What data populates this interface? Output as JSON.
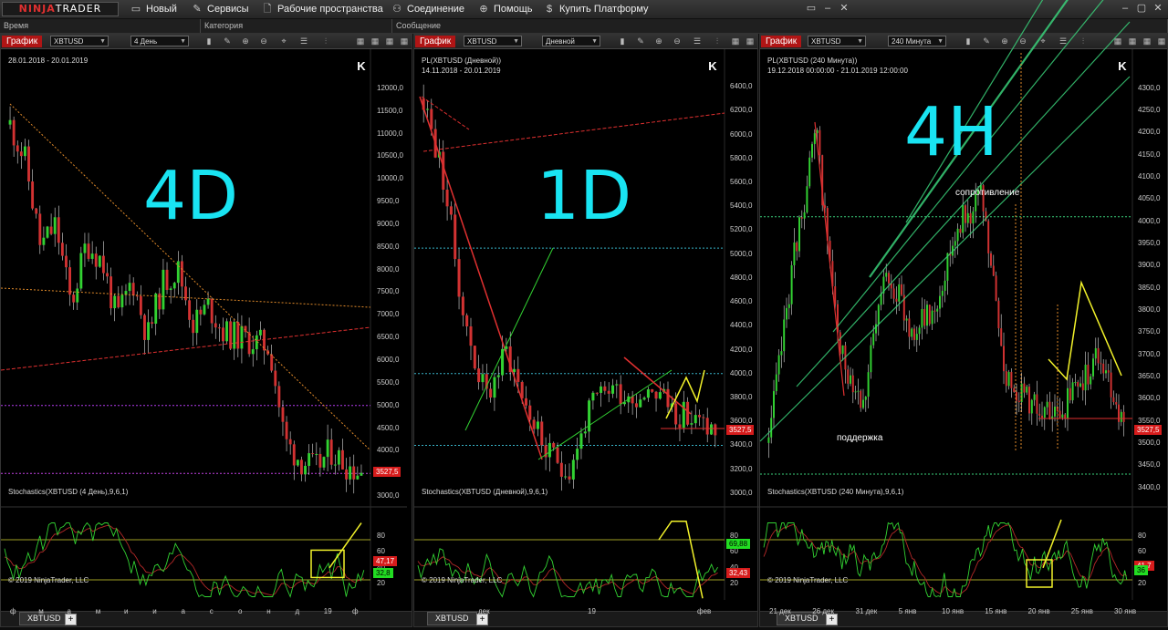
{
  "app": {
    "logo_a": "NINJA",
    "logo_b": "TRADER"
  },
  "menu": [
    {
      "label": "Новый",
      "icon": "window-icon",
      "glyph": "▭"
    },
    {
      "label": "Сервисы",
      "icon": "tools-icon",
      "glyph": "✎"
    },
    {
      "label": "Рабочие пространства",
      "icon": "workspace-icon",
      "glyph": "🗋"
    },
    {
      "label": "Соединение",
      "icon": "plug-icon",
      "glyph": "⚇"
    },
    {
      "label": "Помощь",
      "icon": "lifebuoy-icon",
      "glyph": "⊕"
    },
    {
      "label": "Купить Платформу",
      "icon": "dollar-icon",
      "glyph": "$"
    }
  ],
  "columns": [
    "Время",
    "Категория",
    "Сообщение"
  ],
  "colors": {
    "bull": "#32d232",
    "bear": "#d23232",
    "accent": "#19e4f2",
    "chart_tab": "#b01515"
  },
  "panels": [
    {
      "chart_label": "График",
      "instrument": "XBTUSD",
      "period": "4 День",
      "date_range": "28.01.2018 - 20.01.2019",
      "series_label": "",
      "big_label": "4D",
      "price_tag": "3527,5",
      "y_ticks": [
        "12000,0",
        "11500,0",
        "11000,0",
        "10500,0",
        "10000,0",
        "9500,0",
        "9000,0",
        "8500,0",
        "8000,0",
        "7500,0",
        "7000,0",
        "6500,0",
        "6000,0",
        "5500,0",
        "5000,0",
        "4500,0",
        "4000,0",
        "3500,0",
        "3000,0"
      ],
      "stoch_label": "Stochastics(XBTUSD (4 День),9,6,1)",
      "stoch_ticks": [
        "80",
        "60",
        "40",
        "20"
      ],
      "stoch_tags": {
        "red": "47,17",
        "green": "32,8"
      },
      "x_ticks": [
        "ф",
        "м",
        "а",
        "м",
        "и",
        "и",
        "а",
        "с",
        "о",
        "н",
        "д",
        "19",
        "ф"
      ],
      "copyright": "© 2019 NinjaTrader, LLC",
      "tab": "XBTUSD"
    },
    {
      "chart_label": "График",
      "instrument": "XBTUSD",
      "period": "Дневной",
      "date_range": "14.11.2018 - 20.01.2019",
      "series_label": "PL(XBTUSD (Дневной))",
      "big_label": "1D",
      "price_tag": "3527,5",
      "y_ticks": [
        "6400,0",
        "6200,0",
        "6000,0",
        "5800,0",
        "5600,0",
        "5400,0",
        "5200,0",
        "5000,0",
        "4800,0",
        "4600,0",
        "4400,0",
        "4200,0",
        "4000,0",
        "3800,0",
        "3600,0",
        "3400,0",
        "3200,0",
        "3000,0"
      ],
      "stoch_label": "Stochastics(XBTUSD (Дневной),9,6,1)",
      "stoch_ticks": [
        "80",
        "60",
        "40",
        "20"
      ],
      "stoch_tags": {
        "green": "69,88",
        "red": "32,43"
      },
      "x_ticks": [
        "дек",
        "19",
        "фев"
      ],
      "copyright": "© 2019 NinjaTrader, LLC",
      "tab": "XBTUSD"
    },
    {
      "chart_label": "График",
      "instrument": "XBTUSD",
      "period": "240 Минута",
      "date_range": "19.12.2018 00:00:00 - 21.01.2019 12:00:00",
      "series_label": "PL(XBTUSD (240 Минута))",
      "big_label": "4H",
      "price_tag": "3527,5",
      "resistance": "сопротивление",
      "support": "поддержка",
      "y_ticks": [
        "4300,0",
        "4250,0",
        "4200,0",
        "4150,0",
        "4100,0",
        "4050,0",
        "4000,0",
        "3950,0",
        "3900,0",
        "3850,0",
        "3800,0",
        "3750,0",
        "3700,0",
        "3650,0",
        "3600,0",
        "3550,0",
        "3500,0",
        "3450,0",
        "3400,0"
      ],
      "stoch_label": "Stochastics(XBTUSD (240 Минута),9,6,1)",
      "stoch_ticks": [
        "80",
        "60",
        "40",
        "20"
      ],
      "stoch_tags": {
        "red": "41,7",
        "green": "36"
      },
      "x_ticks": [
        "21 дек",
        "26 дек",
        "31 дек",
        "5 янв",
        "10 янв",
        "15 янв",
        "20 янв",
        "25 янв",
        "30 янв"
      ],
      "copyright": "© 2019 NinjaTrader, LLC",
      "tab": "XBTUSD"
    }
  ],
  "chart_data": [
    {
      "type": "candlestick",
      "period": "4 День",
      "ylim": [
        2800,
        12300
      ],
      "x": [
        "ф",
        "м",
        "а",
        "м",
        "и",
        "и",
        "а",
        "с",
        "о",
        "н",
        "д",
        "19",
        "ф"
      ],
      "close_path": [
        11200,
        10400,
        8500,
        9000,
        7200,
        8600,
        8200,
        6900,
        7800,
        6500,
        7700,
        8000,
        6800,
        7200,
        6600,
        6500,
        6400,
        6300,
        4200,
        3800,
        3600,
        4000,
        3700,
        3527.5
      ],
      "last_price": 3527.5,
      "levels": [
        5000,
        3500
      ],
      "stochastic": {
        "k_last": 32.8,
        "d_last": 47.17,
        "levels": [
          75,
          25
        ]
      }
    },
    {
      "type": "candlestick",
      "period": "Дневной",
      "ylim": [
        2900,
        6500
      ],
      "x": [
        "дек",
        "19",
        "фев"
      ],
      "close_path": [
        6300,
        5600,
        4400,
        3800,
        4200,
        3700,
        3300,
        3200,
        3700,
        3900,
        3800,
        3900,
        3700,
        3600,
        3527.5
      ],
      "last_price": 3527.5,
      "levels": [
        5050,
        4000,
        3400
      ],
      "stochastic": {
        "k_last": 69.88,
        "d_last": 32.43,
        "levels": [
          75,
          25
        ]
      }
    },
    {
      "type": "candlestick",
      "period": "240 Минута",
      "ylim": [
        3360,
        4330
      ],
      "x": [
        "21 дек",
        "26 дек",
        "31 дек",
        "5 янв",
        "10 янв",
        "15 янв",
        "20 янв",
        "25 янв",
        "30 янв"
      ],
      "close_path": [
        3500,
        3900,
        4200,
        3700,
        3600,
        3900,
        3750,
        3800,
        4000,
        4050,
        3650,
        3600,
        3550,
        3620,
        3700,
        3527.5
      ],
      "last_price": 3527.5,
      "levels": [
        4010,
        3430
      ],
      "stochastic": {
        "k_last": 36,
        "d_last": 41.7,
        "levels": [
          75,
          25
        ]
      }
    }
  ]
}
